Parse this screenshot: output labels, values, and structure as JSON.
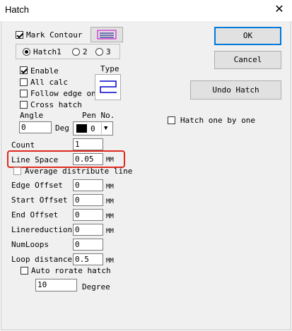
{
  "window": {
    "title": "Hatch",
    "close_glyph": "✕"
  },
  "mark_contour": {
    "label": "Mark Contour",
    "checked": true
  },
  "hatch_group": {
    "options": [
      "Hatch1",
      "2",
      "3"
    ],
    "selected": "Hatch1"
  },
  "enable": {
    "label": "Enable",
    "checked": true
  },
  "all_calc": {
    "label": "All calc",
    "checked": false
  },
  "follow_edge": {
    "label": "Follow edge on",
    "checked": false
  },
  "cross_hatch": {
    "label": "Cross hatch",
    "checked": false
  },
  "type": {
    "label": "Type",
    "icon": "zigzag-hatch-icon"
  },
  "angle": {
    "label": "Angle",
    "value": "0",
    "unit": "Deg"
  },
  "pen": {
    "label": "Pen No.",
    "value": "0",
    "swatch_color": "#000000"
  },
  "count": {
    "label": "Count",
    "value": "1"
  },
  "line_space": {
    "label": "Line Space",
    "value": "0.05",
    "unit": "MM"
  },
  "average_distribute": {
    "label": "Average distribute line",
    "checked": false
  },
  "edge_offset": {
    "label": "Edge Offset",
    "value": "0",
    "unit": "MM"
  },
  "start_offset": {
    "label": "Start Offset",
    "value": "0",
    "unit": "MM"
  },
  "end_offset": {
    "label": "End Offset",
    "value": "0",
    "unit": "MM"
  },
  "linereduction": {
    "label": "Linereduction",
    "value": "0",
    "unit": "MM"
  },
  "numloops": {
    "label": "NumLoops",
    "value": "0"
  },
  "loop_distance": {
    "label": "Loop distance",
    "value": "0.5",
    "unit": "MM"
  },
  "auto_rotate": {
    "label": "Auto rorate hatch",
    "checked": false
  },
  "degree": {
    "value": "10",
    "unit": "Degree"
  },
  "buttons": {
    "ok": "OK",
    "cancel": "Cancel",
    "undo_hatch": "Undo Hatch"
  },
  "hatch_one_by_one": {
    "label": "Hatch one by one",
    "checked": false
  },
  "colors": {
    "highlight": "#e02a1f",
    "accent": "#0078d7"
  }
}
